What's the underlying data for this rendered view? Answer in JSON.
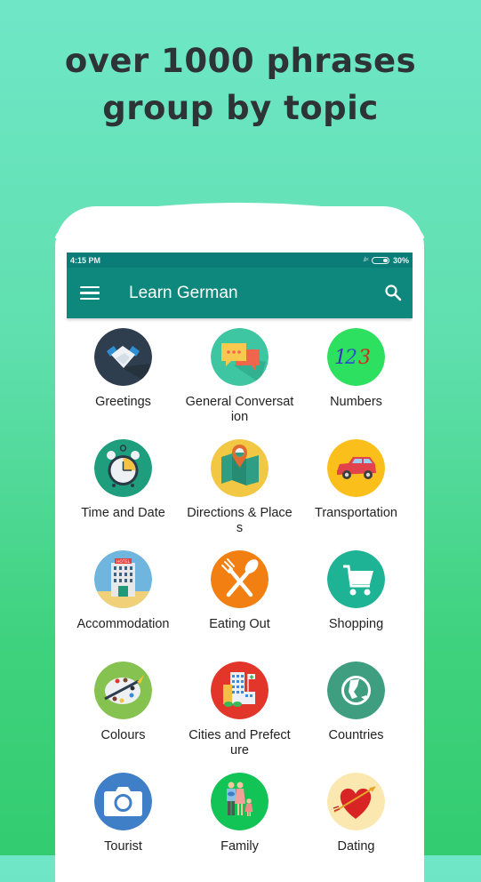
{
  "promo": {
    "line1": "over 1000 phrases",
    "line2": "group by topic"
  },
  "statusbar": {
    "time": "4:15 PM",
    "signal_icon": "signal-no-sim-icon",
    "battery_percent": "30%"
  },
  "appbar": {
    "title": "Learn German",
    "menu_icon": "hamburger-menu-icon",
    "search_icon": "search-icon"
  },
  "colors": {
    "statusbar": "#0b7d78",
    "appbar": "#0e877c",
    "bg_top": "#6fe7c7",
    "bg_bottom": "#33cc70",
    "headline": "#2e3335"
  },
  "topics": [
    {
      "label": "Greetings",
      "icon": "handshake-icon"
    },
    {
      "label": "General Conversation",
      "icon": "chat-bubbles-icon"
    },
    {
      "label": "Numbers",
      "icon": "numbers-123-icon"
    },
    {
      "label": "Time and Date",
      "icon": "alarm-clock-icon"
    },
    {
      "label": "Directions & Places",
      "icon": "map-pin-icon"
    },
    {
      "label": "Transportation",
      "icon": "car-icon"
    },
    {
      "label": "Accommodation",
      "icon": "hotel-icon"
    },
    {
      "label": "Eating Out",
      "icon": "fork-spoon-icon"
    },
    {
      "label": "Shopping",
      "icon": "shopping-cart-icon"
    },
    {
      "label": "Colours",
      "icon": "paint-palette-icon"
    },
    {
      "label": "Cities and Prefecture",
      "icon": "city-buildings-icon"
    },
    {
      "label": "Countries",
      "icon": "globe-icon"
    },
    {
      "label": "Tourist",
      "icon": "camera-icon"
    },
    {
      "label": "Family",
      "icon": "family-icon"
    },
    {
      "label": "Dating",
      "icon": "heart-arrow-icon"
    }
  ]
}
